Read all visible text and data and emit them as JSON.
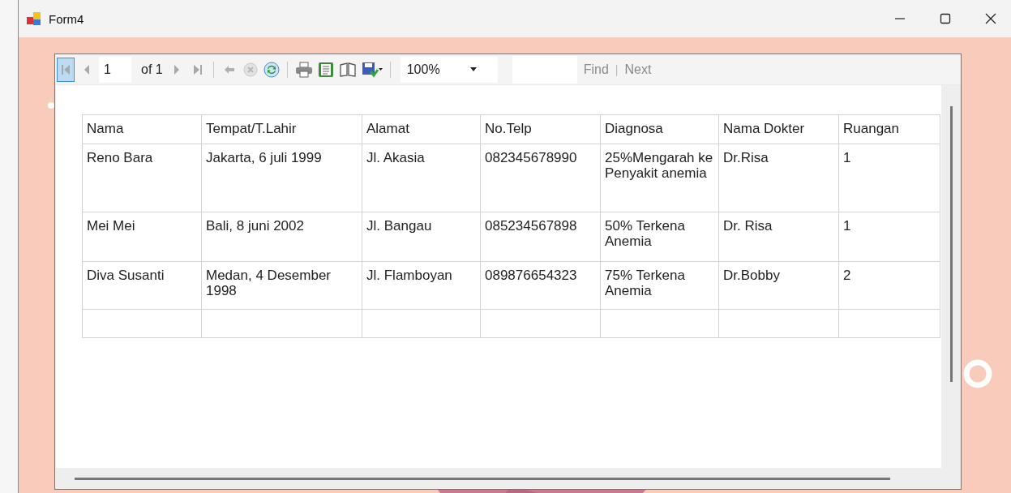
{
  "window": {
    "title": "Form4"
  },
  "toolbar": {
    "page": "1",
    "page_count": "of 1",
    "zoom": "100%",
    "find": {
      "label": "Find",
      "disabled": true
    },
    "find_separator": "|",
    "next": {
      "label": "Next",
      "disabled": true
    },
    "first_page": {
      "selected": true
    },
    "stop": {
      "disabled": true
    }
  },
  "table": {
    "columns": [
      "Nama",
      "Tempat/T.Lahir",
      "Alamat",
      "No.Telp",
      "Diagnosa",
      "Nama Dokter",
      "Ruangan"
    ],
    "rows": [
      [
        "Reno Bara",
        "Jakarta, 6 juli 1999",
        "Jl. Akasia",
        "082345678990",
        "25%Mengarah ke Penyakit anemia",
        "Dr.Risa",
        "1"
      ],
      [
        "Mei Mei",
        "Bali, 8 juni 2002",
        "Jl. Bangau",
        "085234567898",
        "50% Terkena Anemia",
        "Dr. Risa",
        "1"
      ],
      [
        "Diva Susanti",
        "Medan, 4 Desember 1998",
        "Jl. Flamboyan",
        "089876654323",
        "75% Terkena Anemia",
        "Dr.Bobby",
        "2"
      ],
      [
        "",
        "",
        "",
        "",
        "",
        "",
        ""
      ]
    ]
  }
}
